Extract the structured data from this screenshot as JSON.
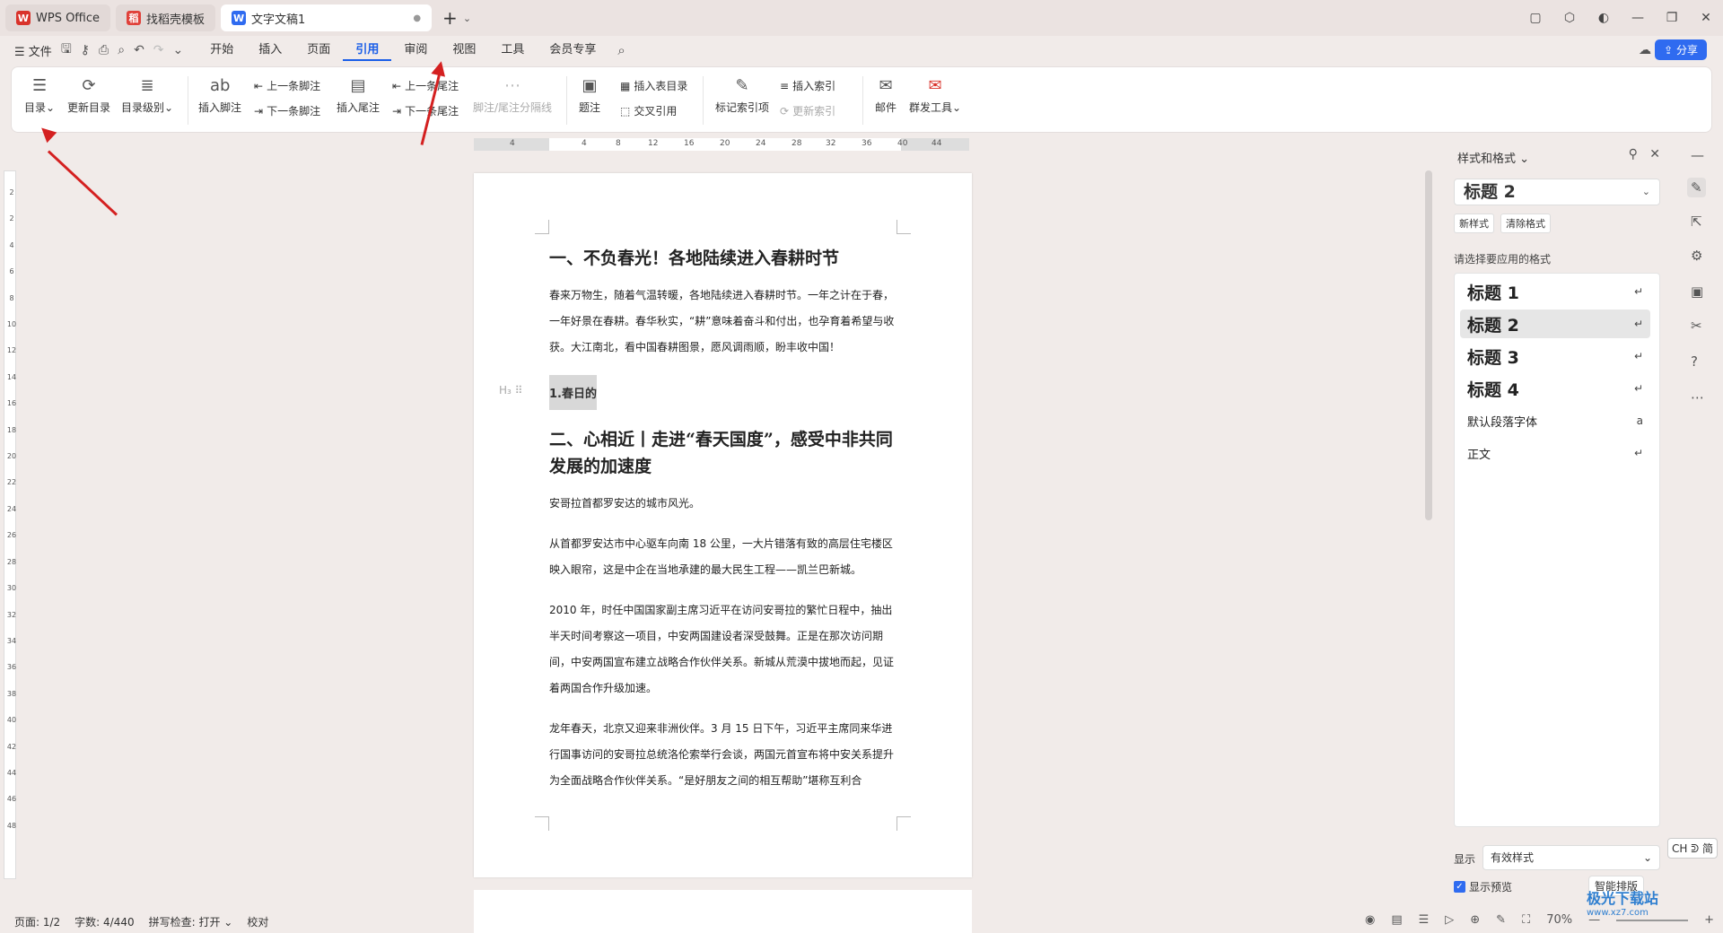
{
  "tabs": [
    {
      "label": "WPS Office",
      "icon": "wps-logo-icon"
    },
    {
      "label": "找稻壳模板",
      "icon": "docer-icon"
    },
    {
      "label": "文字文稿1",
      "icon": "word-doc-icon"
    }
  ],
  "menu": {
    "file": "文件",
    "items": [
      "开始",
      "插入",
      "页面",
      "引用",
      "审阅",
      "视图",
      "工具",
      "会员专享"
    ],
    "active": "引用",
    "share": "分享"
  },
  "ribbon": {
    "toc": "目录",
    "update_toc": "更新目录",
    "toc_level": "目录级别",
    "insert_footnote": "插入脚注",
    "prev_footnote": "上一条脚注",
    "next_footnote": "下一条脚注",
    "insert_endnote": "插入尾注",
    "prev_endnote": "上一条尾注",
    "next_endnote": "下一条尾注",
    "footnote_sep": "脚注/尾注分隔线",
    "caption": "题注",
    "insert_table_of_figures": "插入表目录",
    "cross_ref": "交叉引用",
    "mark_index": "标记索引项",
    "insert_index": "插入索引",
    "update_index": "更新索引",
    "mail": "邮件",
    "mass_tool": "群发工具"
  },
  "ruler": {
    "h_ticks": [
      "4",
      "4",
      "8",
      "12",
      "16",
      "20",
      "24",
      "28",
      "32",
      "36",
      "40",
      "44"
    ],
    "v_ticks": [
      "2",
      "2",
      "4",
      "6",
      "8",
      "10",
      "12",
      "14",
      "16",
      "18",
      "20",
      "22",
      "24",
      "26",
      "28",
      "30",
      "32",
      "34",
      "36",
      "38",
      "40",
      "42",
      "44",
      "46",
      "48"
    ]
  },
  "document": {
    "h1_a": "一、不负春光！各地陆续进入春耕时节",
    "p1": "春来万物生，随着气温转暖，各地陆续进入春耕时节。一年之计在于春，一年好景在春耕。春华秋实，“耕”意味着奋斗和付出，也孕育着希望与收获。大江南北，看中国春耕图景，愿风调雨顺，盼丰收中国！",
    "h3": "1.春日的",
    "h_marker": "H₃",
    "h1_b": "二、心相近丨走进“春天国度”，感受中非共同发展的加速度",
    "p2": "安哥拉首都罗安达的城市风光。",
    "p3": "从首都罗安达市中心驱车向南 18 公里，一大片错落有致的高层住宅楼区映入眼帘，这是中企在当地承建的最大民生工程——凯兰巴新城。",
    "p4": "2010 年，时任中国国家副主席习近平在访问安哥拉的繁忙日程中，抽出半天时间考察这一项目，中安两国建设者深受鼓舞。正是在那次访问期间，中安两国宣布建立战略合作伙伴关系。新城从荒漠中拔地而起，见证着两国合作升级加速。",
    "p5": "龙年春天，北京又迎来非洲伙伴。3 月 15 日下午，习近平主席同来华进行国事访问的安哥拉总统洛伦索举行会谈，两国元首宣布将中安关系提升为全面战略合作伙伴关系。“是好朋友之间的相互帮助”堪称互利合"
  },
  "sidebar": {
    "title": "样式和格式",
    "current_style": "标题 2",
    "new_style": "新样式",
    "clear_format": "清除格式",
    "apply_label": "请选择要应用的格式",
    "styles": [
      {
        "name": "标题 1",
        "mark": "↵"
      },
      {
        "name": "标题 2",
        "mark": "↵",
        "selected": true
      },
      {
        "name": "标题 3",
        "mark": "↵"
      },
      {
        "name": "标题 4",
        "mark": "↵"
      },
      {
        "name": "默认段落字体",
        "mark": "a"
      },
      {
        "name": "正文",
        "mark": "↵"
      }
    ],
    "display_label": "显示",
    "display_value": "有效样式",
    "preview_label": "显示预览",
    "smart_layout": "智能排版"
  },
  "ime": "CH ᕲ 简",
  "status": {
    "page": "页面: 1/2",
    "words": "字数: 4/440",
    "spell": "拼写检查: 打开",
    "proof": "校对",
    "zoom": "70%"
  },
  "watermark": "极光下载站",
  "watermark_url": "www.xz7.com",
  "colors": {
    "accent": "#1a5ee8",
    "arrow": "#d42020",
    "share": "#2f6bf0"
  }
}
